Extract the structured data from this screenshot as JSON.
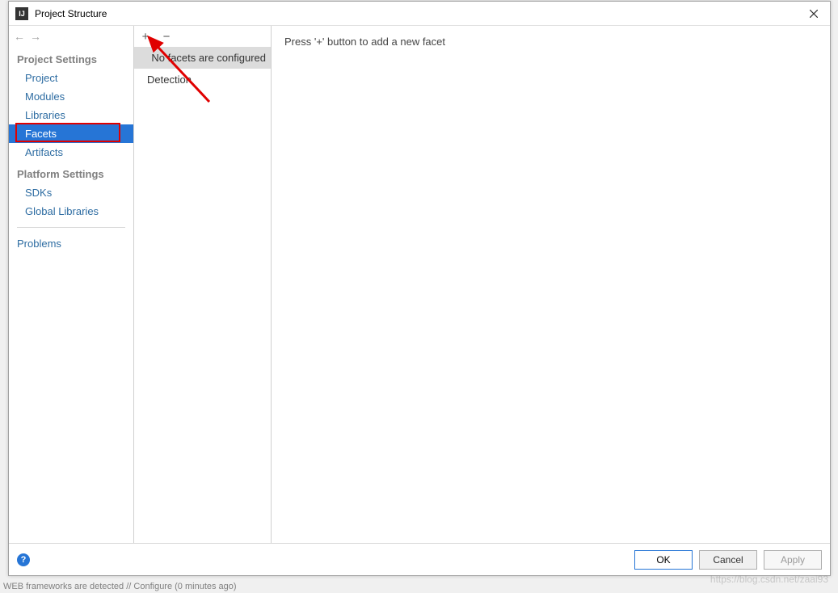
{
  "window": {
    "title": "Project Structure"
  },
  "nav": {
    "back_enabled": false,
    "forward_enabled": false,
    "project_settings_header": "Project Settings",
    "items_project": [
      {
        "label": "Project",
        "selected": false
      },
      {
        "label": "Modules",
        "selected": false
      },
      {
        "label": "Libraries",
        "selected": false
      },
      {
        "label": "Facets",
        "selected": true
      },
      {
        "label": "Artifacts",
        "selected": false
      }
    ],
    "platform_settings_header": "Platform Settings",
    "items_platform": [
      {
        "label": "SDKs",
        "selected": false
      },
      {
        "label": "Global Libraries",
        "selected": false
      }
    ],
    "problems_label": "Problems"
  },
  "mid": {
    "add_icon": "+",
    "remove_icon": "−",
    "rows": [
      {
        "label": "No facets are configured",
        "selected": true
      },
      {
        "label": "Detection",
        "selected": false
      }
    ]
  },
  "right": {
    "hint": "Press '+' button to add a new facet"
  },
  "footer": {
    "ok": "OK",
    "cancel": "Cancel",
    "apply": "Apply",
    "help": "?"
  },
  "annotations": {
    "redbox_target": "Facets",
    "arrow_points_to": "add-facet-button"
  },
  "status": "WEB frameworks are detected // Configure (0 minutes ago)",
  "watermark": "https://blog.csdn.net/zaai93"
}
